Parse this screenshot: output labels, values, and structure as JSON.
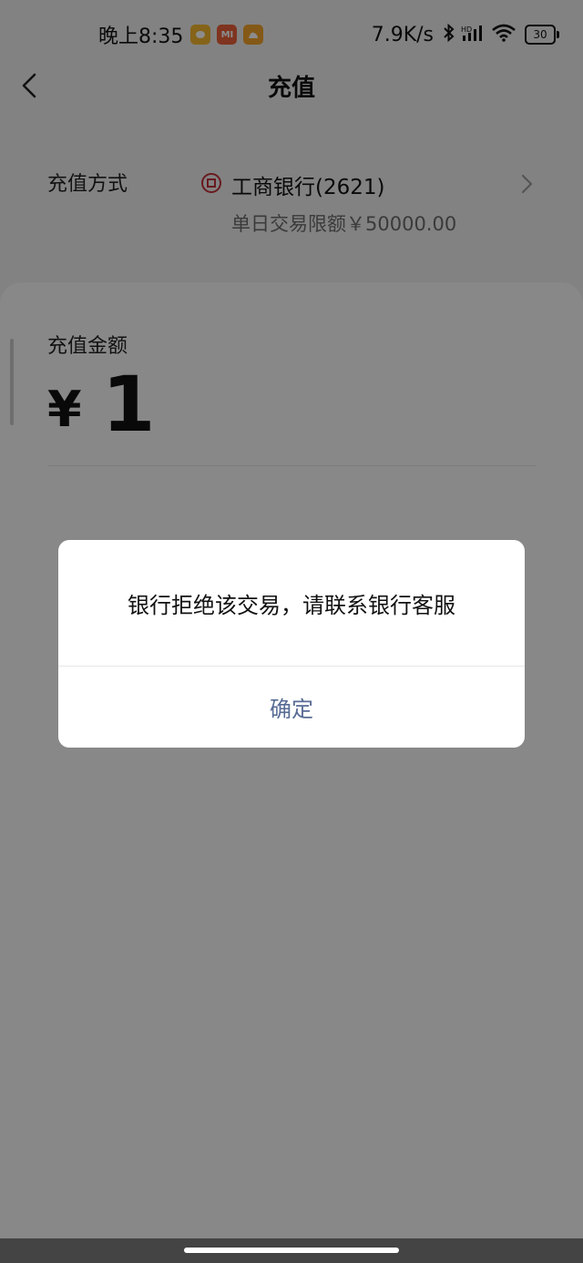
{
  "status_bar": {
    "time": "晚上8:35",
    "app_badges": [
      {
        "label": "",
        "color": "#f2b630"
      },
      {
        "label": "MI",
        "color": "#e8603a"
      },
      {
        "label": "",
        "color": "#f0a22a"
      }
    ],
    "network_speed": "7.9K/s",
    "battery": "30"
  },
  "nav": {
    "title": "充值"
  },
  "payment_method": {
    "label": "充值方式",
    "bank_name": "工商银行(2621)",
    "limit": "单日交易限额￥50000.00"
  },
  "amount": {
    "label": "充值金额",
    "currency": "¥",
    "value": "1"
  },
  "dialog": {
    "message": "银行拒绝该交易，请联系银行客服",
    "confirm_label": "确定"
  },
  "colors": {
    "accent": "#576b95",
    "bank_brand": "#c0313a",
    "overlay": "rgba(0,0,0,0.45)"
  }
}
